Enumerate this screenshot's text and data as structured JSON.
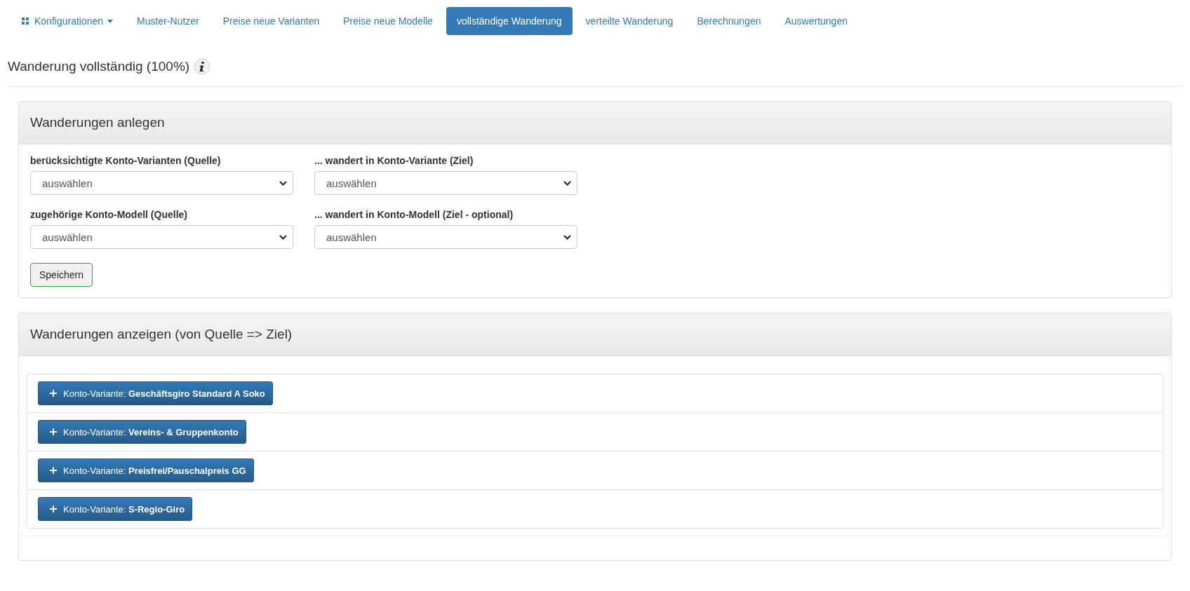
{
  "nav": {
    "items": [
      {
        "kind": "dropdown",
        "label": "Konfigurationen",
        "selected": false
      },
      {
        "kind": "link",
        "label": "Muster-Nutzer",
        "selected": false
      },
      {
        "kind": "link",
        "label": "Preise neue Varianten",
        "selected": false
      },
      {
        "kind": "link",
        "label": "Preise neue Modelle",
        "selected": false
      },
      {
        "kind": "link",
        "label": "vollständige Wanderung",
        "selected": true
      },
      {
        "kind": "link",
        "label": "verteilte Wanderung",
        "selected": false
      },
      {
        "kind": "link",
        "label": "Berechnungen",
        "selected": false
      },
      {
        "kind": "link",
        "label": "Auswertungen",
        "selected": false
      }
    ]
  },
  "page_title": "Wanderung vollständig (100%)",
  "create_panel": {
    "title": "Wanderungen anlegen",
    "fields": [
      {
        "label": "berücksichtigte Konto-Varianten (Quelle)",
        "value": "auswählen"
      },
      {
        "label": "... wandert in Konto-Variante (Ziel)",
        "value": "auswählen"
      },
      {
        "label": "zugehörige Konto-Modell (Quelle)",
        "value": "auswählen"
      },
      {
        "label": "... wandert in Konto-Modell (Ziel - optional)",
        "value": "auswählen"
      }
    ],
    "save_button": "Speichern"
  },
  "list_panel": {
    "title": "Wanderungen anzeigen (von Quelle => Ziel)",
    "items": [
      {
        "label": "Konto-Variante: **Geschäftsgiro Standard A Soko**",
        "expanded": false
      },
      {
        "label": "Konto-Variante: **Vereins- & Gruppenkonto**",
        "expanded": false
      },
      {
        "label": "Konto-Variante: **Preisfrei/Pauschalpreis GG**",
        "expanded": false
      },
      {
        "label": "Konto-Variante: **S-Regio-Giro**",
        "expanded": false
      }
    ]
  }
}
